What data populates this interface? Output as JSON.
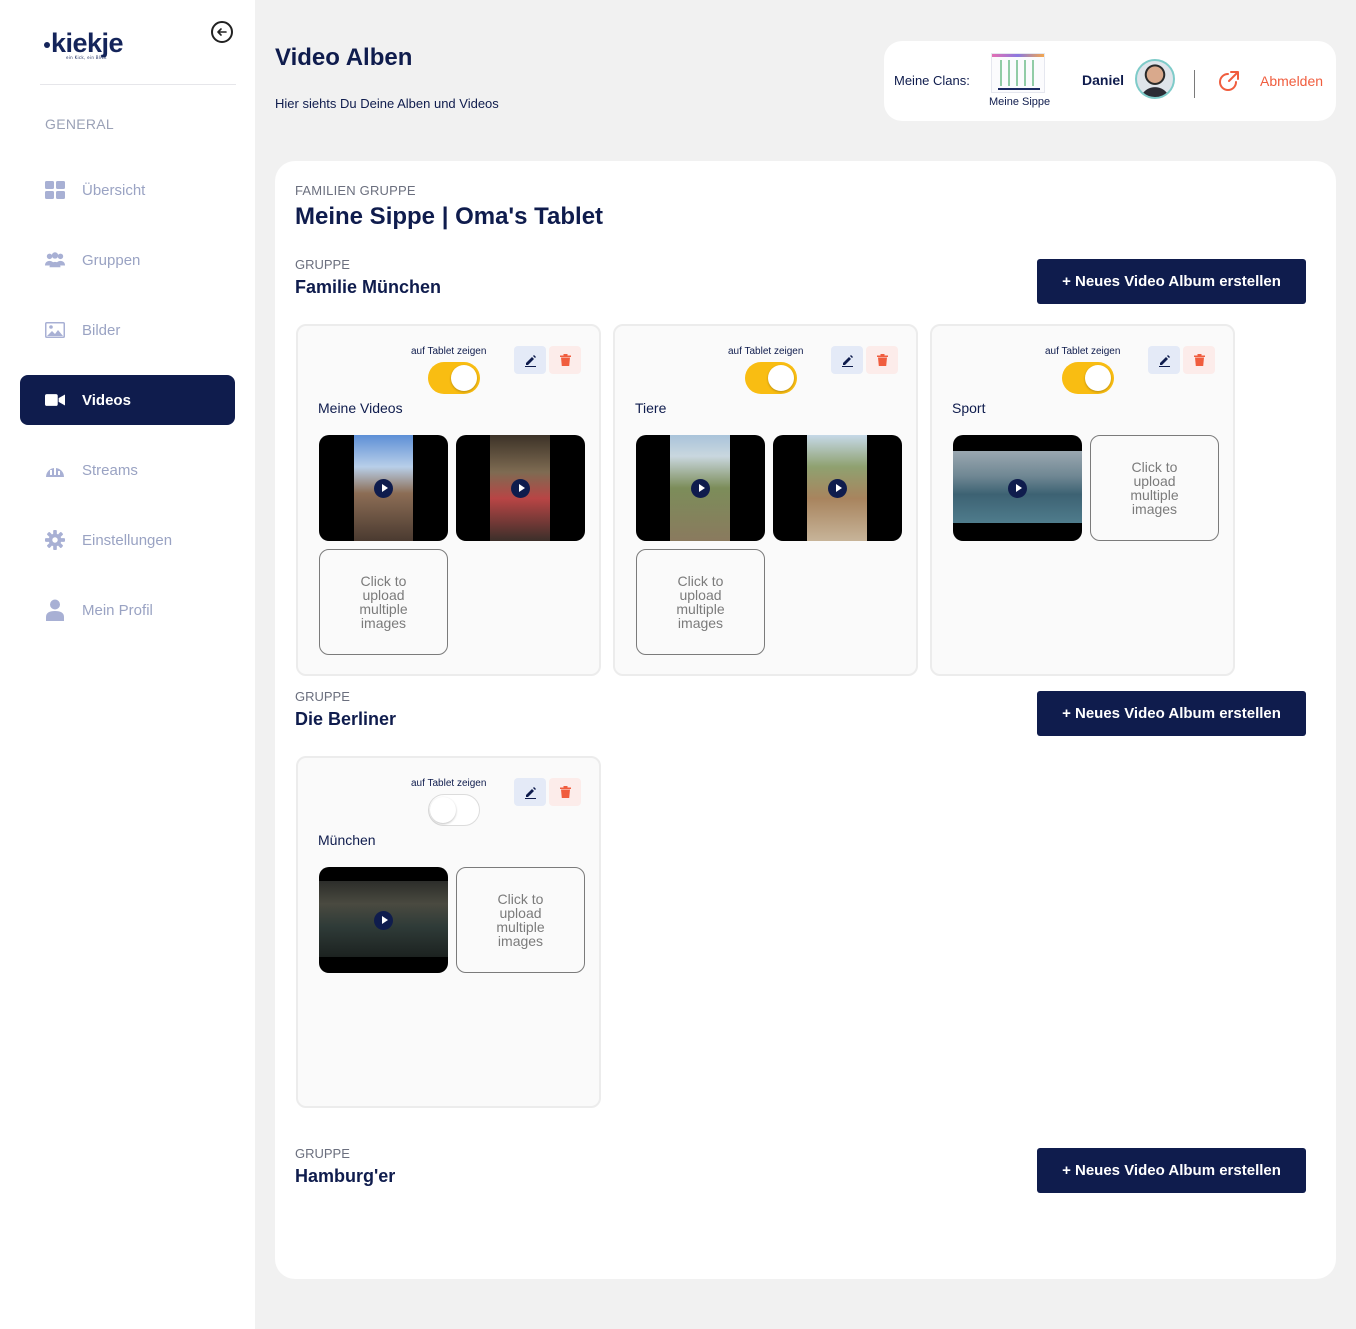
{
  "sidebar": {
    "logo_text": "kiekje",
    "logo_tagline": "ein Kick, ein Blick",
    "section_label": "GENERAL",
    "items": [
      {
        "label": "Übersicht",
        "icon": "grid-icon"
      },
      {
        "label": "Gruppen",
        "icon": "group-icon"
      },
      {
        "label": "Bilder",
        "icon": "image-icon"
      },
      {
        "label": "Videos",
        "icon": "video-camera-icon"
      },
      {
        "label": "Streams",
        "icon": "streams-icon"
      },
      {
        "label": "Einstellungen",
        "icon": "gear-icon"
      },
      {
        "label": "Mein Profil",
        "icon": "user-icon"
      }
    ],
    "active_item": "Videos"
  },
  "header": {
    "title": "Video Alben",
    "subtitle": "Hier siehts Du Deine Alben und Videos",
    "clans_label": "Meine Clans:",
    "clan_name": "Meine Sippe",
    "user_name": "Daniel",
    "logout_label": "Abmelden"
  },
  "family": {
    "label": "FAMILIEN GRUPPE",
    "title": "Meine Sippe | Oma's Tablet"
  },
  "common": {
    "group_label": "GRUPPE",
    "new_album_button": "+ Neues Video Album erstellen",
    "toggle_label": "auf Tablet zeigen",
    "upload_text": "Click to upload multiple images"
  },
  "groups": [
    {
      "name": "Familie München",
      "albums": [
        {
          "name": "Meine Videos",
          "show_on_tablet": true,
          "videos": 2
        },
        {
          "name": "Tiere",
          "show_on_tablet": true,
          "videos": 2
        },
        {
          "name": "Sport",
          "show_on_tablet": true,
          "videos": 1
        }
      ]
    },
    {
      "name": "Die Berliner",
      "albums": [
        {
          "name": "München",
          "show_on_tablet": false,
          "videos": 1
        }
      ]
    },
    {
      "name": "Hamburg'er",
      "albums": []
    }
  ],
  "colors": {
    "primary": "#0f1c4d",
    "toggle_on": "#f9bd12",
    "logout": "#f05d3e",
    "delete": "#f05d3e"
  }
}
